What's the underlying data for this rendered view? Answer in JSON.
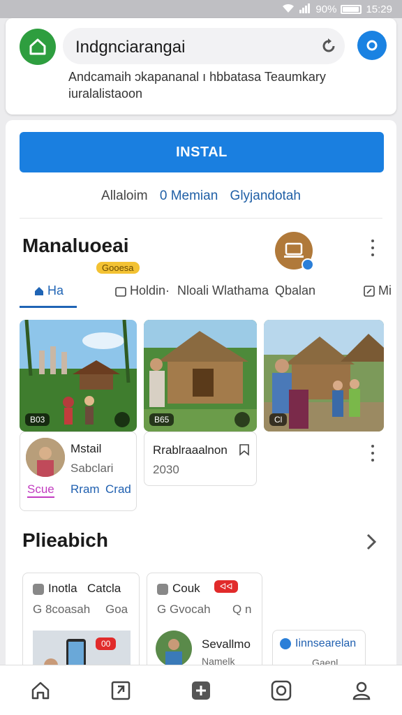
{
  "status_bar": {
    "battery": "90%",
    "time": "15:29"
  },
  "header": {
    "search_text": "Indgnciarangai",
    "description": "Andcamaih ɔkapananal ı hbbatasa Teaumkary iuralalistaoon"
  },
  "install_label": "INSTAL",
  "links": [
    "Allaloim",
    "0 Memian",
    "Glyjandotah"
  ],
  "section1": {
    "title": "Manaluoeai",
    "badge": "Gooesa",
    "tabs": [
      "Ha",
      "Holdin·",
      "Nloali Wlathama",
      "Qbalan",
      "Mi"
    ],
    "cards": [
      {
        "tag": "B03",
        "detail_title": "Mstail",
        "detail_sub": "Sabclari",
        "link1": "Scue",
        "link2": "Rram",
        "link3": "Crad"
      },
      {
        "tag": "B65",
        "detail_title": "Rrablraaalnon",
        "detail_sub": "2030"
      },
      {
        "tag": "Cl"
      }
    ]
  },
  "section2": {
    "title": "Plieabich",
    "cards": [
      {
        "title": "Inotla",
        "title2": "Catcla",
        "sub": "G 8coasah",
        "sub2": "Goa",
        "badge": ""
      },
      {
        "title": "Couk",
        "sub": "G Gvocah",
        "sub2": "Q n",
        "badge": "ᐊᐊ"
      }
    ],
    "row2": [
      {
        "badge": "00",
        "caption": ""
      },
      {
        "title": "Sevallmo",
        "sub": "Namelk"
      },
      {
        "title": "Iinnsearelan",
        "sub": "Gaenl"
      }
    ]
  },
  "colors": {
    "accent": "#1a7fe0",
    "logo_green": "#2e9e3f",
    "badge_yellow": "#f3c233",
    "badge_red": "#e12b2b"
  }
}
